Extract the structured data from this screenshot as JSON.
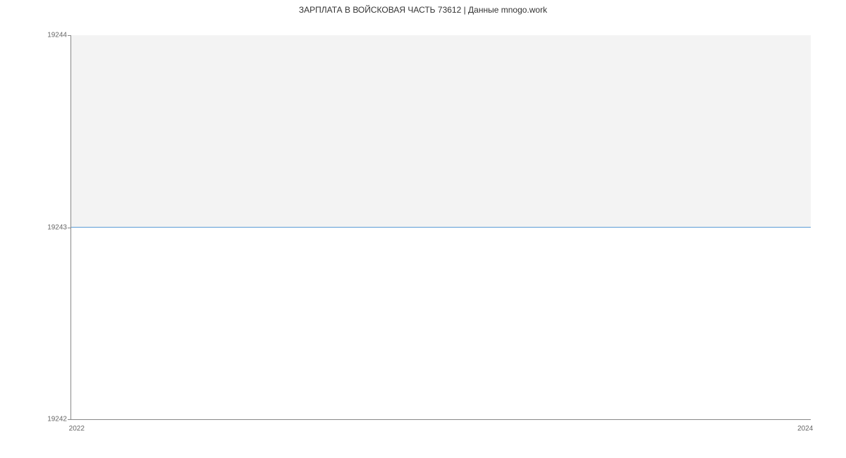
{
  "chart_data": {
    "type": "area",
    "title": "ЗАРПЛАТА В ВОЙСКОВАЯ ЧАСТЬ 73612 | Данные mnogo.work",
    "xlabel": "",
    "ylabel": "",
    "x": [
      2022,
      2024
    ],
    "values": [
      19243,
      19243
    ],
    "ylim": [
      19242,
      19244
    ],
    "y_ticks": [
      "19244",
      "19243",
      "19242"
    ],
    "x_ticks": [
      "2022",
      "2024"
    ],
    "colors": {
      "line": "#5b9bd5",
      "fill": "#f3f3f3",
      "axis": "#888888"
    }
  }
}
